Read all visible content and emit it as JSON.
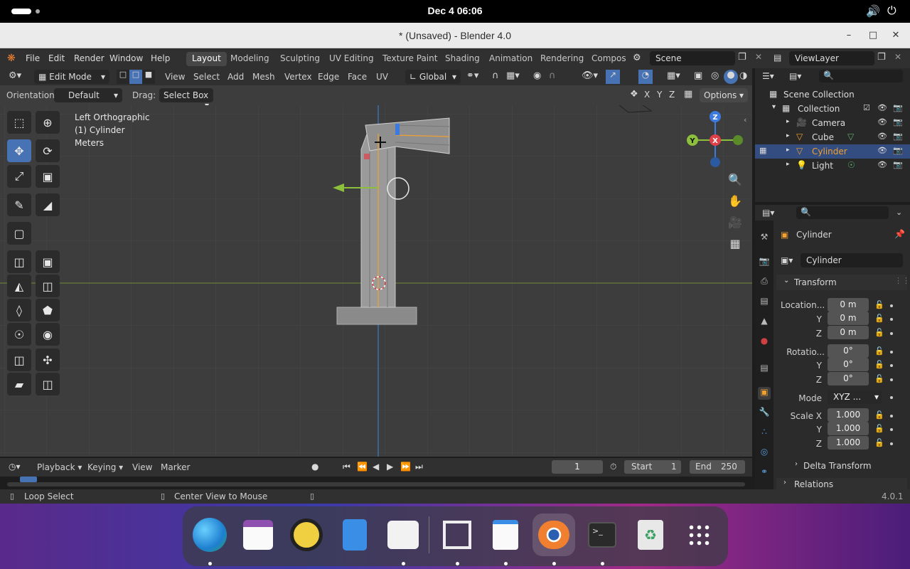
{
  "topbar": {
    "clock": "Dec 4  06:06"
  },
  "window": {
    "title": "* (Unsaved) - Blender 4.0",
    "min": "–",
    "max": "□",
    "close": "✕"
  },
  "menubar": {
    "menus": [
      "File",
      "Edit",
      "Render",
      "Window",
      "Help"
    ],
    "workspaces": [
      "Layout",
      "Modeling",
      "Sculpting",
      "UV Editing",
      "Texture Paint",
      "Shading",
      "Animation",
      "Rendering",
      "Compos"
    ],
    "active_workspace": "Layout",
    "scene": "Scene",
    "view_layer": "ViewLayer"
  },
  "header": {
    "mode": "Edit Mode",
    "menus": [
      "View",
      "Select",
      "Add",
      "Mesh",
      "Vertex",
      "Edge",
      "Face",
      "UV"
    ],
    "transform_orientation": "Global"
  },
  "toolsettings": {
    "orientation_label": "Orientation:",
    "orientation_value": "Default",
    "drag_label": "Drag:",
    "drag_value": "Select Box",
    "axes": [
      "X",
      "Y",
      "Z"
    ],
    "options": "Options"
  },
  "viewport": {
    "view_name": "Left Orthographic",
    "object_info": "(1) Cylinder",
    "units": "Meters",
    "gizmo": {
      "z": "Z",
      "x": "X",
      "y": "Y"
    }
  },
  "outliner": {
    "search_placeholder": "",
    "items": [
      {
        "label": "Scene Collection",
        "indent": 0
      },
      {
        "label": "Collection",
        "indent": 1
      },
      {
        "label": "Camera",
        "indent": 2
      },
      {
        "label": "Cube",
        "indent": 2
      },
      {
        "label": "Cylinder",
        "indent": 2,
        "selected": true
      },
      {
        "label": "Light",
        "indent": 2
      }
    ]
  },
  "properties": {
    "object_name": "Cylinder",
    "data_name": "Cylinder",
    "transform_header": "Transform",
    "location": {
      "label": "Location...",
      "x": "0 m",
      "y": "0 m",
      "z": "0 m"
    },
    "rotation": {
      "label": "Rotatio...",
      "x": "0°",
      "y": "0°",
      "z": "0°"
    },
    "mode": {
      "label": "Mode",
      "value": "XYZ ..."
    },
    "scale": {
      "label": "Scale X",
      "x": "1.000",
      "y": "1.000",
      "z": "1.000"
    },
    "axis_y": "Y",
    "axis_z": "Z",
    "delta_transform": "Delta Transform",
    "relations": "Relations"
  },
  "timeline": {
    "menus": [
      "Playback",
      "Keying",
      "View",
      "Marker"
    ],
    "current_frame": "1",
    "start_label": "Start",
    "start_value": "1",
    "end_label": "End",
    "end_value": "250"
  },
  "statusbar": {
    "left": "Loop Select",
    "middle": "Center View to Mouse",
    "version": "4.0.1"
  },
  "colors": {
    "accent": "#4772b3",
    "x_axis": "#e0404a",
    "y_axis": "#8cc03c",
    "z_axis": "#3c7ae0",
    "active_object": "#f0a030"
  }
}
